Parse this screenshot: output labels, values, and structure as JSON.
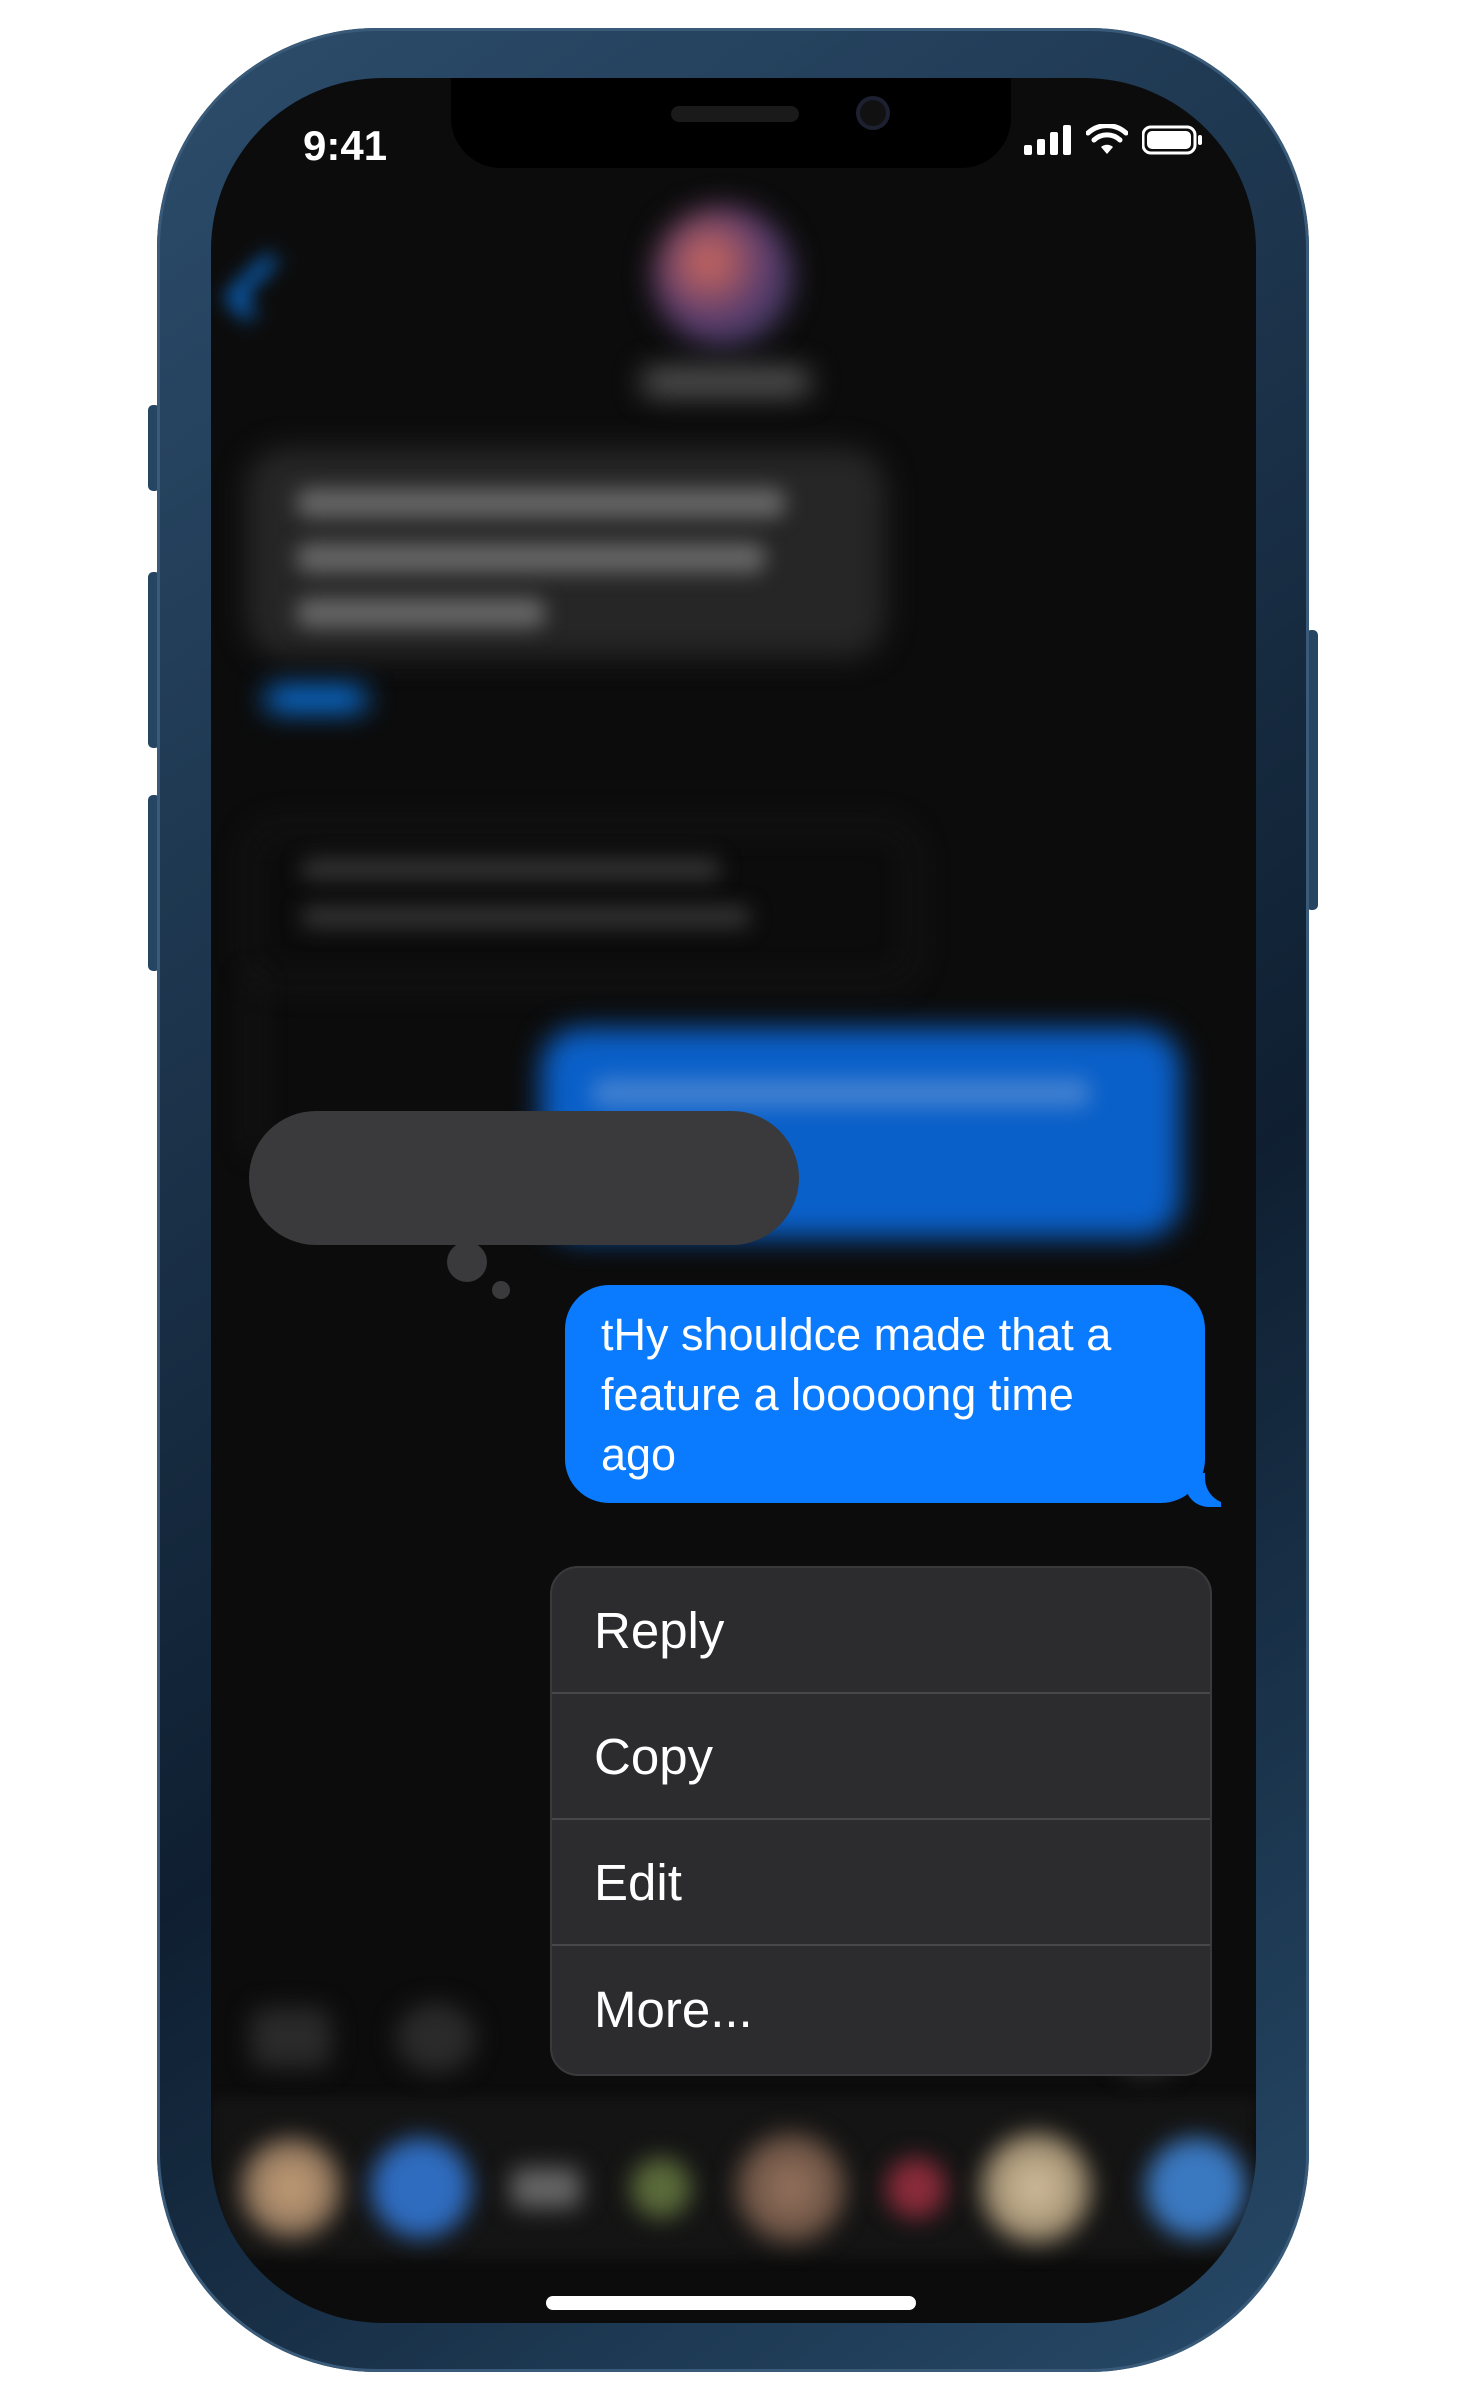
{
  "status_bar": {
    "time": "9:41"
  },
  "message": {
    "text_line1": "tHy shouldce made that a",
    "text_line2": "feature a looooong time",
    "text_line3": "ago"
  },
  "context_menu": {
    "items": [
      {
        "label": "Reply"
      },
      {
        "label": "Copy"
      },
      {
        "label": "Edit"
      },
      {
        "label": "More..."
      }
    ]
  },
  "colors": {
    "accent": "#0a7aff",
    "menu_bg": "#2c2c2e",
    "screen_bg": "#0c0c0c"
  },
  "icons": [
    "signal-icon",
    "wifi-icon",
    "battery-icon",
    "back-chevron-icon"
  ]
}
